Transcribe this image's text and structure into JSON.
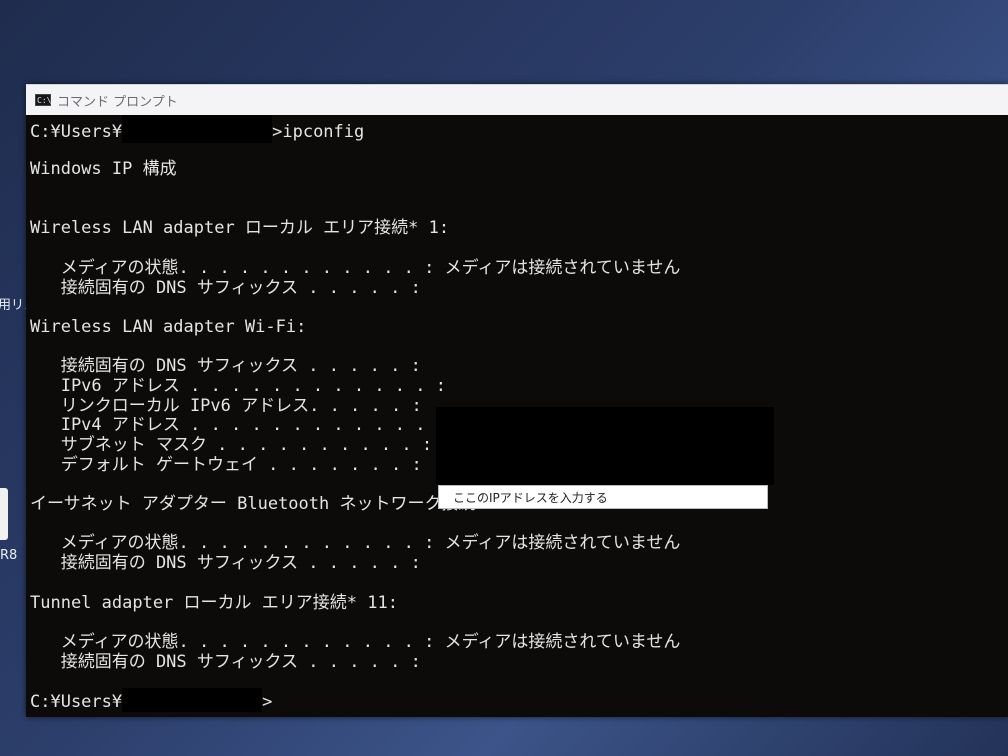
{
  "window": {
    "title": "コマンド プロンプト",
    "icon": "cmd-icon"
  },
  "desktop": {
    "fringe_text_1": "用リス",
    "fringe_text_2": "R8"
  },
  "console": {
    "lines": [
      "C:¥Users¥",
      ">ipconfig",
      "",
      "Windows IP 構成",
      "",
      "",
      "Wireless LAN adapter ローカル エリア接続* 1:",
      "",
      "   メディアの状態. . . . . . . . . . . . : メディアは接続されていません",
      "   接続固有の DNS サフィックス . . . . . :",
      "",
      "Wireless LAN adapter Wi-Fi:",
      "",
      "   接続固有の DNS サフィックス . . . . . :",
      "   IPv6 アドレス . . . . . . . . . . . . :",
      "   リンクローカル IPv6 アドレス. . . . . :",
      "   IPv4 アドレス . . . . . . . . . . . . :",
      "   サブネット マスク . . . . . . . . . . :",
      "   デフォルト ゲートウェイ . . . . . . . :",
      "",
      "イーサネット アダプター Bluetooth ネットワーク接続:",
      "",
      "   メディアの状態. . . . . . . . . . . . : メディアは接続されていません",
      "   接続固有の DNS サフィックス . . . . . :",
      "",
      "Tunnel adapter ローカル エリア接続* 11:",
      "",
      "   メディアの状態. . . . . . . . . . . . : メディアは接続されていません",
      "   接続固有の DNS サフィックス . . . . . :",
      "",
      "C:¥Users¥",
      ">"
    ]
  },
  "annotation": {
    "note": "ここのIPアドレスを入力する"
  }
}
